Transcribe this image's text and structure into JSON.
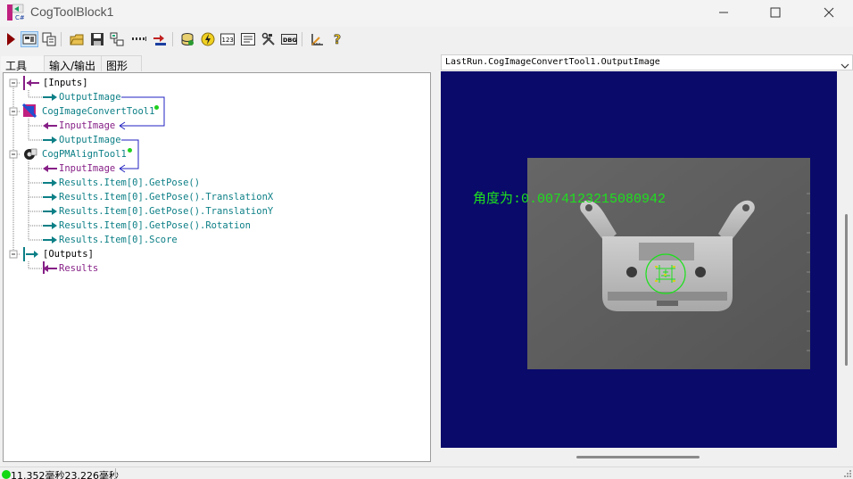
{
  "window": {
    "title": "CogToolBlock1"
  },
  "tabs": [
    {
      "label": "工具",
      "active": true
    },
    {
      "label": "输入/输出",
      "active": false
    },
    {
      "label": "图形",
      "active": false
    }
  ],
  "toolbar": {
    "icons": [
      "run-icon",
      "display-toggle-icon",
      "copy-icon",
      "open-icon",
      "save-icon",
      "link-icon",
      "dotted-line-icon",
      "arrow-in-icon",
      "database-icon",
      "lightning-icon",
      "numbers-icon",
      "list-icon",
      "tools-icon",
      "dbg-icon",
      "ruler-icon",
      "help-icon"
    ]
  },
  "tree": {
    "inputs_label": "[Inputs]",
    "input_output_image": "OutputImage",
    "tool1_name": "CogImageConvertTool1",
    "tool1_input": "InputImage",
    "tool1_output": "OutputImage",
    "tool2_name": "CogPMAlignTool1",
    "tool2_input": "InputImage",
    "tool2_results": [
      "Results.Item[0].GetPose()",
      "Results.Item[0].GetPose().TranslationX",
      "Results.Item[0].GetPose().TranslationY",
      "Results.Item[0].GetPose().Rotation",
      "Results.Item[0].Score"
    ],
    "outputs_label": "[Outputs]",
    "output_results": "Results"
  },
  "display": {
    "selected_image": "LastRun.CogImageConvertTool1.OutputImage",
    "angle_label": "角度为:0.0074123215080942",
    "background_color": "#0a0a6b",
    "graphic_color": "#1ee01e"
  },
  "status": {
    "text": "11.352毫秒23.226毫秒",
    "indicator_color": "#13d813"
  }
}
